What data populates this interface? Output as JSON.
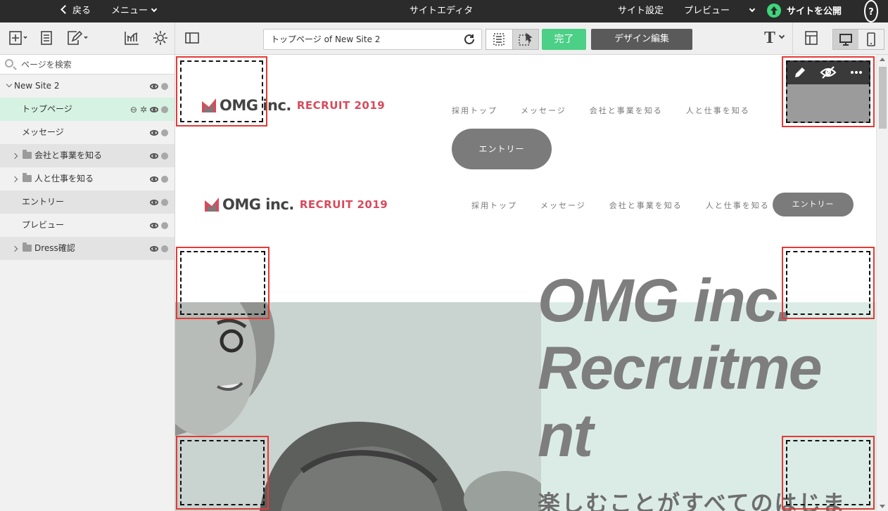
{
  "topbar": {
    "back": "戻る",
    "menu": "メニュー",
    "title": "サイトエディタ",
    "site_settings": "サイト設定",
    "preview": "プレビュー",
    "publish": "サイトを公開",
    "help": "?"
  },
  "toolbar": {
    "url": "トップページ of New Site 2",
    "done": "完了",
    "design_edit": "デザイン編集",
    "text_tool": "T"
  },
  "sidebar": {
    "search_placeholder": "ページを検索",
    "items": [
      {
        "label": "New Site 2"
      },
      {
        "label": "トップページ"
      },
      {
        "label": "メッセージ"
      },
      {
        "label": "会社と事業を知る"
      },
      {
        "label": "人と仕事を知る"
      },
      {
        "label": "エントリー"
      },
      {
        "label": "プレビュー"
      },
      {
        "label": "Dress確認"
      }
    ]
  },
  "site": {
    "logo_name": "OMG inc.",
    "logo_recruit": "RECRUIT 2019",
    "nav": [
      "採用トップ",
      "メッセージ",
      "会社と事業を知る",
      "人と仕事を知る"
    ],
    "entry": "エントリー",
    "hero_line1": "OMG inc.",
    "hero_line2": "Recruitme",
    "hero_line3": "nt",
    "hero_sub": "楽しむことがすべてのはじま"
  },
  "colors": {
    "publish": "#3dd67a",
    "done": "#4ccf86",
    "brand_red": "#d94a5b",
    "hero_bg": "#dbece7"
  }
}
